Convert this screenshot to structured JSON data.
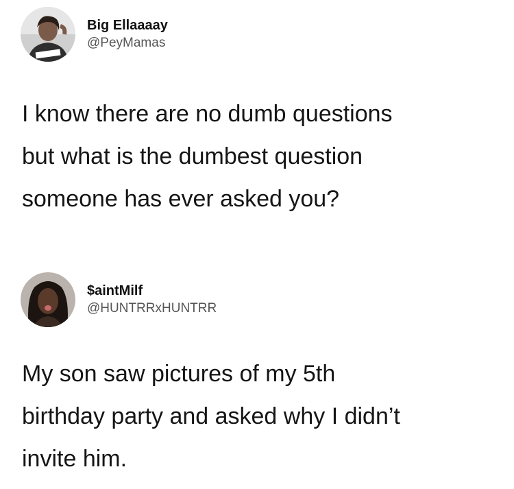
{
  "tweets": [
    {
      "author": {
        "display_name": "Big Ellaaaay",
        "handle": "@PeyMamas",
        "avatar_icon": "profile-photo-icon"
      },
      "text": "I know there are no dumb questions\nbut what is the dumbest question\nsomeone has ever asked you?"
    },
    {
      "author": {
        "display_name": "$aintMilf",
        "handle": "@HUNTRRxHUNTRR",
        "avatar_icon": "profile-photo-icon"
      },
      "text": "My son saw pictures of my 5th\nbirthday party and asked why I didn’t\ninvite him."
    }
  ]
}
